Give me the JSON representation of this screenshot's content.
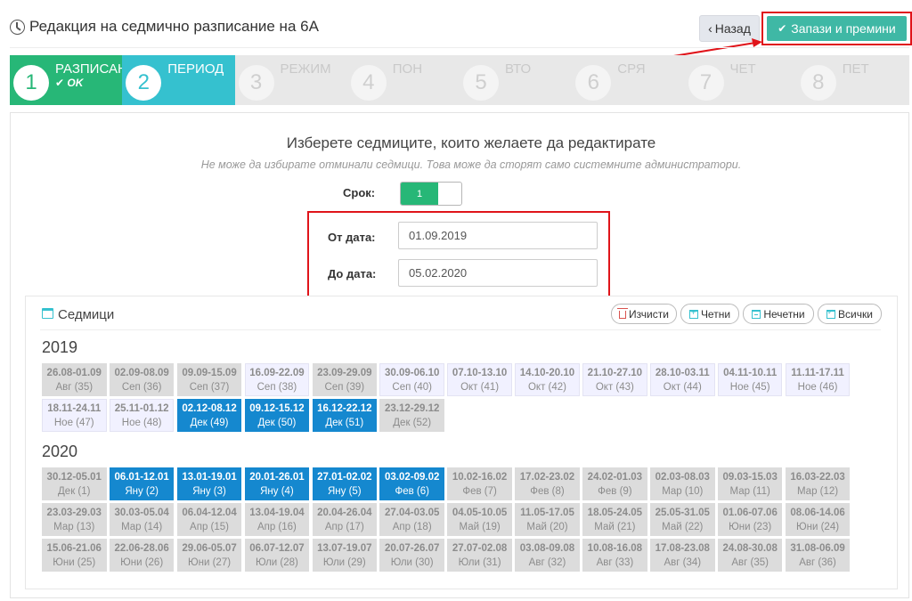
{
  "header": {
    "title": "Редакция на седмично разписание на 6А",
    "back_label": "Назад",
    "save_label": "Запази и премини"
  },
  "steps": [
    {
      "num": "1",
      "label": "РАЗПИСАН",
      "status": "OK",
      "state": "done"
    },
    {
      "num": "2",
      "label": "ПЕРИОД",
      "status": "",
      "state": "active"
    },
    {
      "num": "3",
      "label": "РЕЖИМ",
      "status": "",
      "state": "pending"
    },
    {
      "num": "4",
      "label": "ПОН",
      "status": "",
      "state": "pending"
    },
    {
      "num": "5",
      "label": "ВТО",
      "status": "",
      "state": "pending"
    },
    {
      "num": "6",
      "label": "СРЯ",
      "status": "",
      "state": "pending"
    },
    {
      "num": "7",
      "label": "ЧЕТ",
      "status": "",
      "state": "pending"
    },
    {
      "num": "8",
      "label": "ПЕТ",
      "status": "",
      "state": "pending"
    }
  ],
  "selection": {
    "title": "Изберете седмиците, които желаете да редактирате",
    "note": "Не може да избирате отминали седмици. Това може да сторят само системните администратори.",
    "term_label": "Срок:",
    "term_value": "1",
    "from_label": "От дата:",
    "from_value": "01.09.2019",
    "to_label": "До дата:",
    "to_value": "05.02.2020"
  },
  "weeks_panel": {
    "title": "Седмици",
    "clear_label": "Изчисти",
    "even_label": "Четни",
    "odd_label": "Нечетни",
    "all_label": "Всички"
  },
  "years": [
    {
      "year": "2019",
      "weeks": [
        {
          "range": "26.08-01.09",
          "label": "Авг (35)",
          "state": "past"
        },
        {
          "range": "02.09-08.09",
          "label": "Сеп (36)",
          "state": "past"
        },
        {
          "range": "09.09-15.09",
          "label": "Сеп (37)",
          "state": "past"
        },
        {
          "range": "16.09-22.09",
          "label": "Сеп (38)",
          "state": "future"
        },
        {
          "range": "23.09-29.09",
          "label": "Сеп (39)",
          "state": "past"
        },
        {
          "range": "30.09-06.10",
          "label": "Сеп (40)",
          "state": "future"
        },
        {
          "range": "07.10-13.10",
          "label": "Окт (41)",
          "state": "future"
        },
        {
          "range": "14.10-20.10",
          "label": "Окт (42)",
          "state": "future"
        },
        {
          "range": "21.10-27.10",
          "label": "Окт (43)",
          "state": "future"
        },
        {
          "range": "28.10-03.11",
          "label": "Окт (44)",
          "state": "future"
        },
        {
          "range": "04.11-10.11",
          "label": "Ное (45)",
          "state": "future"
        },
        {
          "range": "11.11-17.11",
          "label": "Ное (46)",
          "state": "future"
        },
        {
          "range": "18.11-24.11",
          "label": "Ное (47)",
          "state": "future"
        },
        {
          "range": "25.11-01.12",
          "label": "Ное (48)",
          "state": "future"
        },
        {
          "range": "02.12-08.12",
          "label": "Дек (49)",
          "state": "selected"
        },
        {
          "range": "09.12-15.12",
          "label": "Дек (50)",
          "state": "selected"
        },
        {
          "range": "16.12-22.12",
          "label": "Дек (51)",
          "state": "selected"
        },
        {
          "range": "23.12-29.12",
          "label": "Дек (52)",
          "state": "past"
        }
      ]
    },
    {
      "year": "2020",
      "weeks": [
        {
          "range": "30.12-05.01",
          "label": "Дек (1)",
          "state": "past"
        },
        {
          "range": "06.01-12.01",
          "label": "Яну (2)",
          "state": "selected"
        },
        {
          "range": "13.01-19.01",
          "label": "Яну (3)",
          "state": "selected"
        },
        {
          "range": "20.01-26.01",
          "label": "Яну (4)",
          "state": "selected"
        },
        {
          "range": "27.01-02.02",
          "label": "Яну (5)",
          "state": "selected"
        },
        {
          "range": "03.02-09.02",
          "label": "Фев (6)",
          "state": "selected"
        },
        {
          "range": "10.02-16.02",
          "label": "Фев (7)",
          "state": "past"
        },
        {
          "range": "17.02-23.02",
          "label": "Фев (8)",
          "state": "past"
        },
        {
          "range": "24.02-01.03",
          "label": "Фев (9)",
          "state": "past"
        },
        {
          "range": "02.03-08.03",
          "label": "Мар (10)",
          "state": "past"
        },
        {
          "range": "09.03-15.03",
          "label": "Мар (11)",
          "state": "past"
        },
        {
          "range": "16.03-22.03",
          "label": "Мар (12)",
          "state": "past"
        },
        {
          "range": "23.03-29.03",
          "label": "Мар (13)",
          "state": "past"
        },
        {
          "range": "30.03-05.04",
          "label": "Мар (14)",
          "state": "past"
        },
        {
          "range": "06.04-12.04",
          "label": "Апр (15)",
          "state": "past"
        },
        {
          "range": "13.04-19.04",
          "label": "Апр (16)",
          "state": "past"
        },
        {
          "range": "20.04-26.04",
          "label": "Апр (17)",
          "state": "past"
        },
        {
          "range": "27.04-03.05",
          "label": "Апр (18)",
          "state": "past"
        },
        {
          "range": "04.05-10.05",
          "label": "Май (19)",
          "state": "past"
        },
        {
          "range": "11.05-17.05",
          "label": "Май (20)",
          "state": "past"
        },
        {
          "range": "18.05-24.05",
          "label": "Май (21)",
          "state": "past"
        },
        {
          "range": "25.05-31.05",
          "label": "Май (22)",
          "state": "past"
        },
        {
          "range": "01.06-07.06",
          "label": "Юни (23)",
          "state": "past"
        },
        {
          "range": "08.06-14.06",
          "label": "Юни (24)",
          "state": "past"
        },
        {
          "range": "15.06-21.06",
          "label": "Юни (25)",
          "state": "past"
        },
        {
          "range": "22.06-28.06",
          "label": "Юни (26)",
          "state": "past"
        },
        {
          "range": "29.06-05.07",
          "label": "Юни (27)",
          "state": "past"
        },
        {
          "range": "06.07-12.07",
          "label": "Юли (28)",
          "state": "past"
        },
        {
          "range": "13.07-19.07",
          "label": "Юли (29)",
          "state": "past"
        },
        {
          "range": "20.07-26.07",
          "label": "Юли (30)",
          "state": "past"
        },
        {
          "range": "27.07-02.08",
          "label": "Юли (31)",
          "state": "past"
        },
        {
          "range": "03.08-09.08",
          "label": "Авг (32)",
          "state": "past"
        },
        {
          "range": "10.08-16.08",
          "label": "Авг (33)",
          "state": "past"
        },
        {
          "range": "17.08-23.08",
          "label": "Авг (34)",
          "state": "past"
        },
        {
          "range": "24.08-30.08",
          "label": "Авг (35)",
          "state": "past"
        },
        {
          "range": "31.08-06.09",
          "label": "Авг (36)",
          "state": "past"
        }
      ]
    }
  ]
}
